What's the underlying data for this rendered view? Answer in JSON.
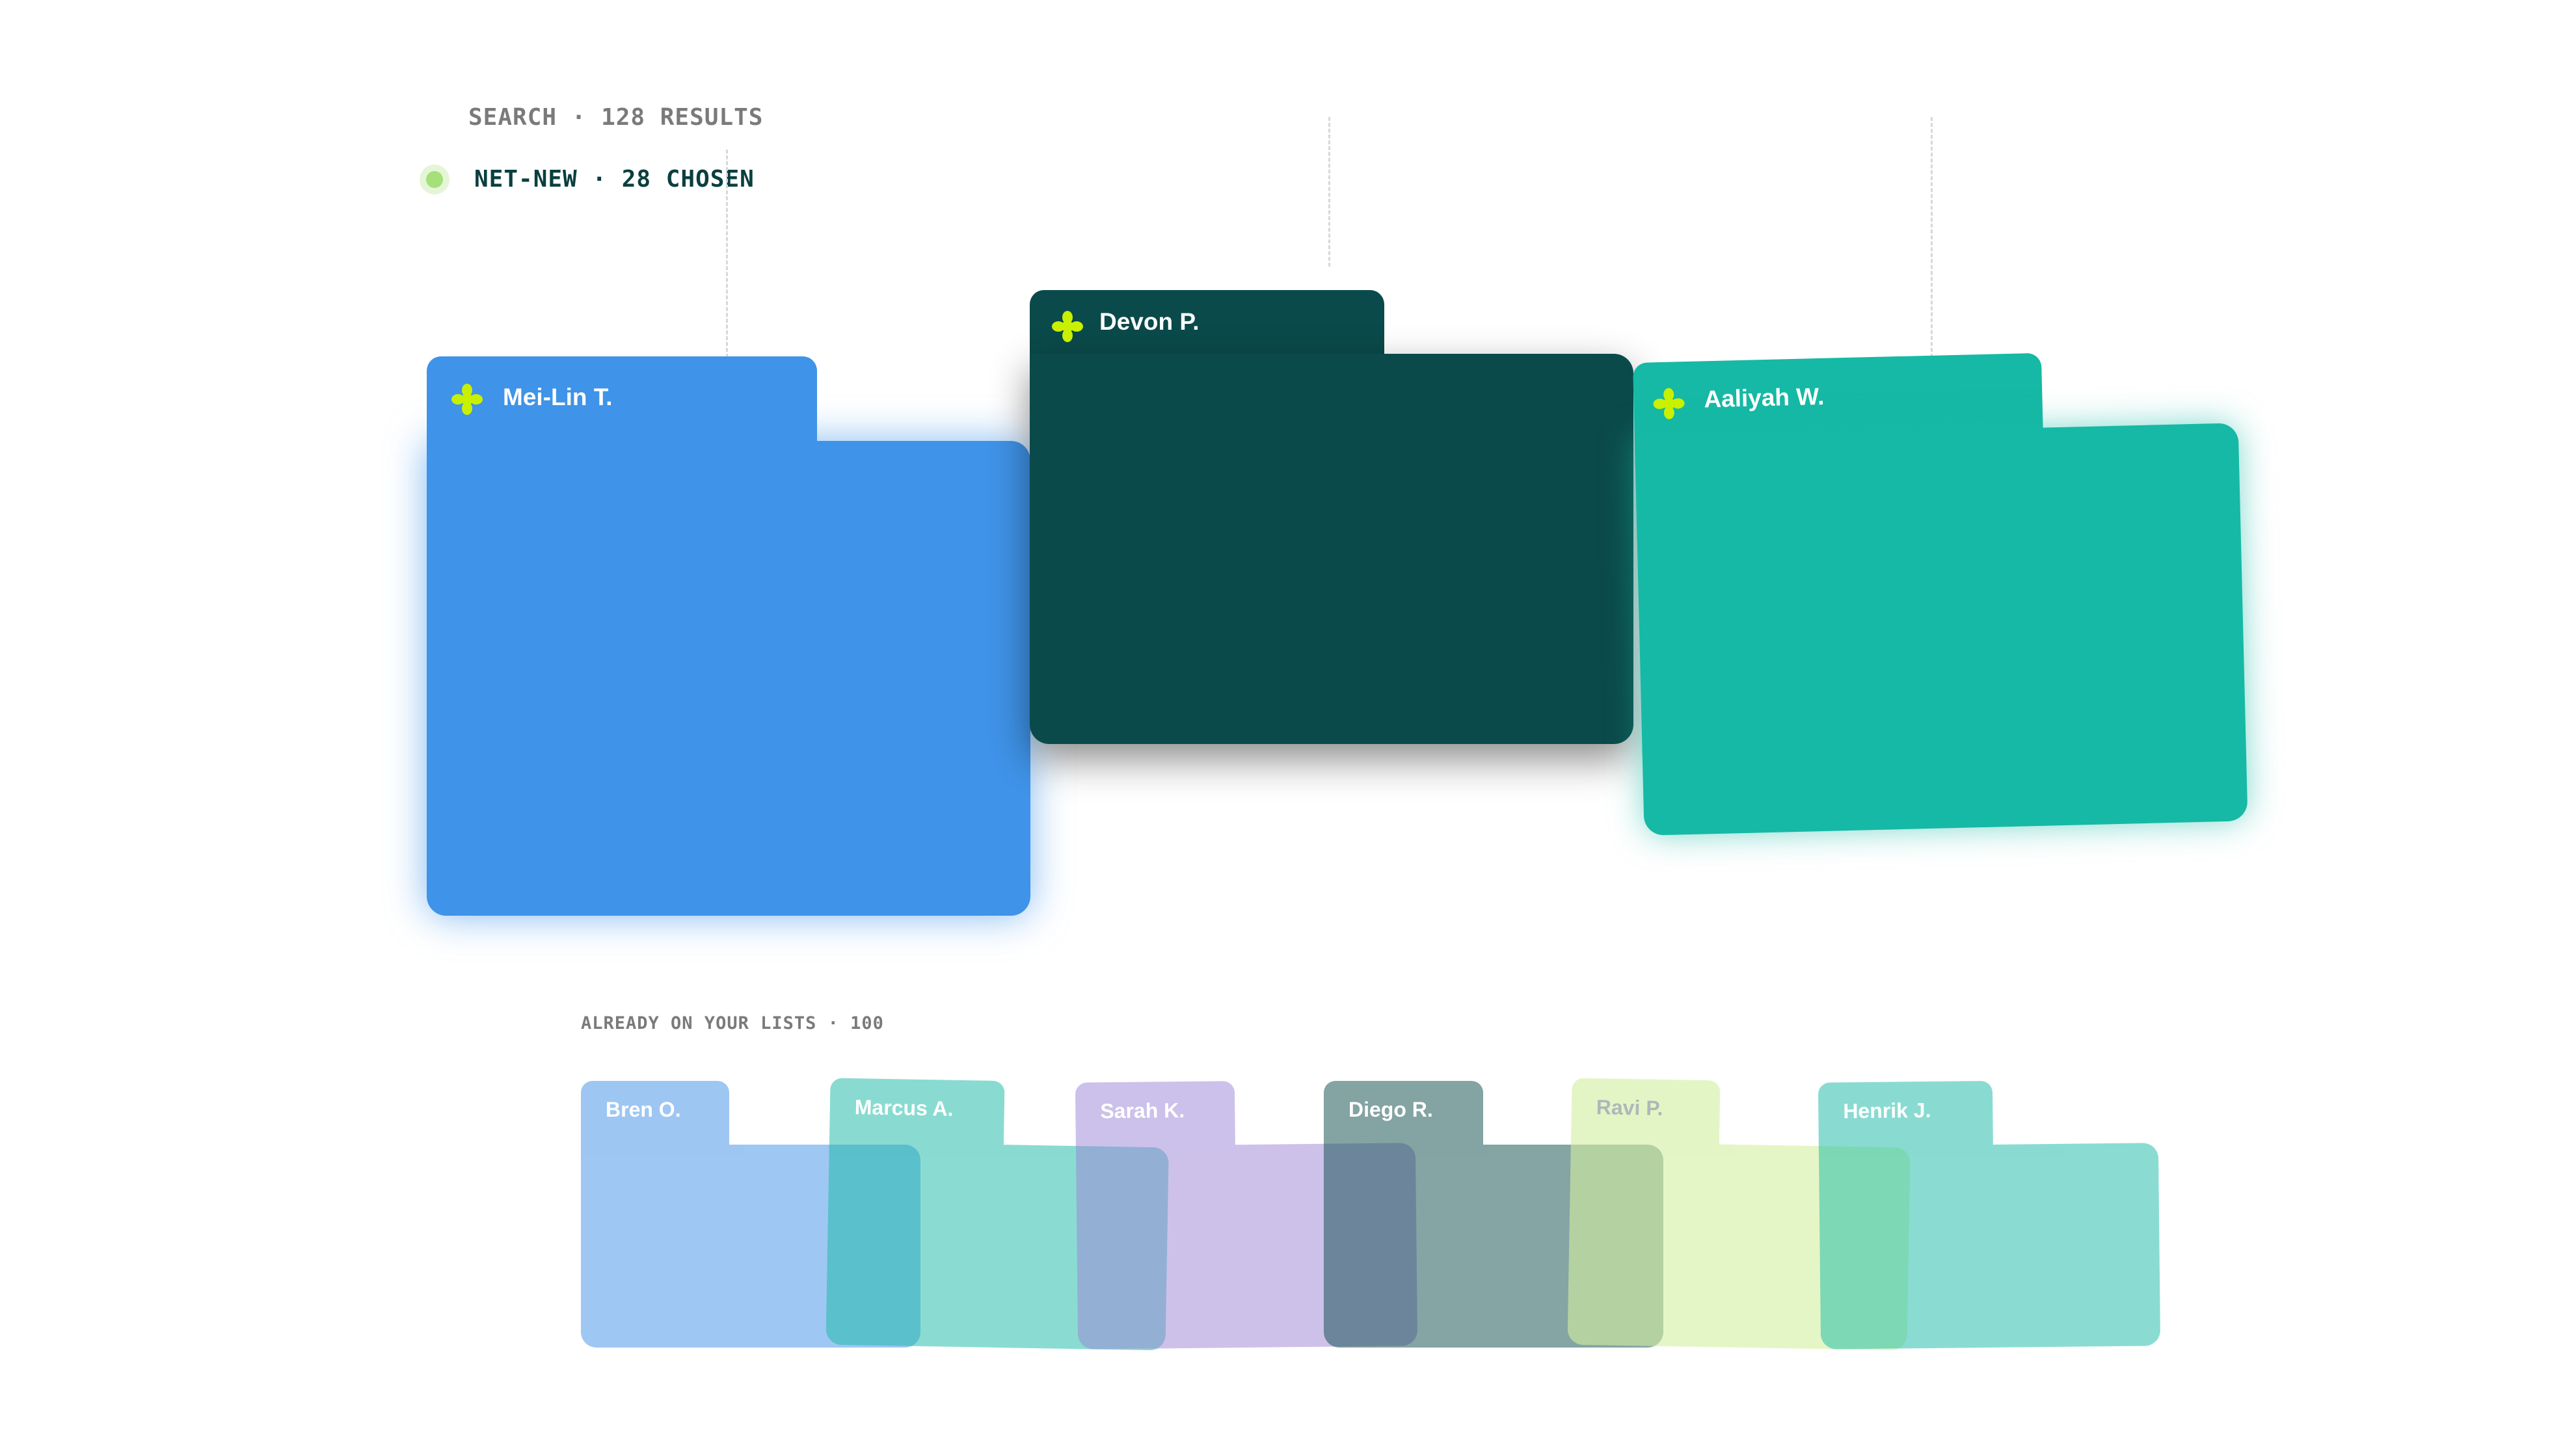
{
  "header": {
    "search_label": "SEARCH · 128 RESULTS",
    "netnew_label": "NET-NEW · 28 CHOSEN"
  },
  "featured": [
    {
      "name": "Mei-Lin T.",
      "color": "#3f93e8"
    },
    {
      "name": "Devon P.",
      "color": "#0b4a4a"
    },
    {
      "name": "Aaliyah W.",
      "color": "#16b9a5"
    }
  ],
  "existing": {
    "label": "ALREADY ON YOUR LISTS · 100",
    "items": [
      {
        "name": "Bren O.",
        "color": "#3f8fe8"
      },
      {
        "name": "Marcus A.",
        "color": "#16b9a5"
      },
      {
        "name": "Sarah K.",
        "color": "#9b84d6"
      },
      {
        "name": "Diego R.",
        "color": "#0b4a4a"
      },
      {
        "name": "Ravi P.",
        "color": "#d3f0a0"
      },
      {
        "name": "Henrik J.",
        "color": "#16b9a5"
      }
    ]
  },
  "icons": {
    "featured_marker": "asterisk-flower-icon",
    "status_marker": "status-dot-icon"
  },
  "accent_star_color": "#c8f000"
}
